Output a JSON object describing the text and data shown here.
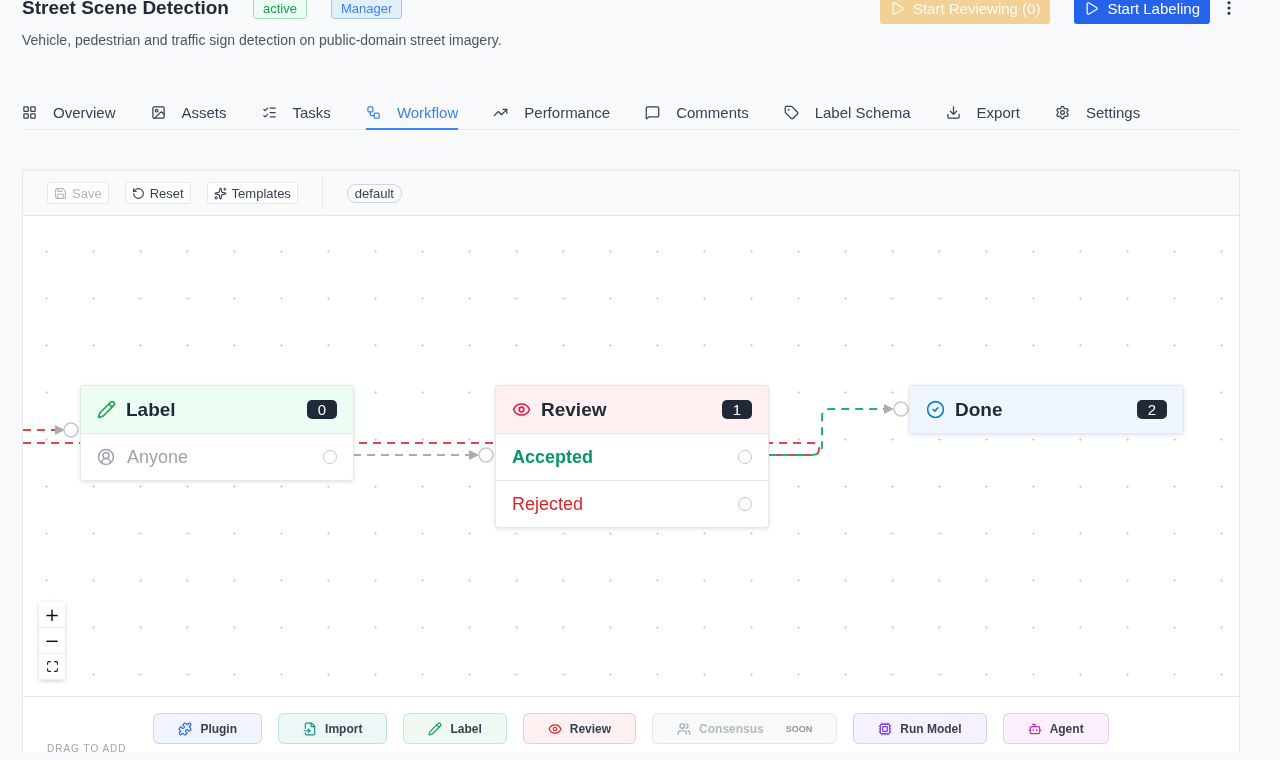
{
  "header": {
    "title": "Street Scene Detection",
    "status_badge": "active",
    "role_badge": "Manager",
    "description": "Vehicle, pedestrian and traffic sign detection on public-domain street imagery.",
    "actions": [
      {
        "label": "Start Reviewing (0)",
        "kind": "review",
        "disabled": true
      },
      {
        "label": "Start Labeling",
        "kind": "label",
        "disabled": false
      }
    ]
  },
  "tabs": [
    {
      "label": "Overview",
      "selected": false
    },
    {
      "label": "Assets",
      "selected": false
    },
    {
      "label": "Tasks",
      "selected": false
    },
    {
      "label": "Workflow",
      "selected": true
    },
    {
      "label": "Performance",
      "selected": false
    },
    {
      "label": "Comments",
      "selected": false
    },
    {
      "label": "Label Schema",
      "selected": false
    },
    {
      "label": "Export",
      "selected": false
    },
    {
      "label": "Settings",
      "selected": false
    }
  ],
  "toolbar": {
    "buttons": [
      {
        "label": "Save",
        "kind": "save",
        "disabled": true
      },
      {
        "label": "Reset",
        "kind": "reset",
        "disabled": false
      },
      {
        "label": "Templates",
        "kind": "templates",
        "disabled": false
      }
    ],
    "workflow_name": "default"
  },
  "nodes": [
    {
      "kind": "label",
      "title": "Label",
      "count": "0",
      "rows": [
        {
          "text": "Anyone",
          "kind": "assignee"
        }
      ]
    },
    {
      "kind": "review",
      "title": "Review",
      "count": "1",
      "rows": [
        {
          "text": "Accepted",
          "kind": "accept"
        },
        {
          "text": "Rejected",
          "kind": "reject"
        }
      ]
    },
    {
      "kind": "done",
      "title": "Done",
      "count": "2"
    }
  ],
  "zoom_controls": [
    "+",
    "−"
  ],
  "palette": {
    "items": [
      {
        "label": "Plugin",
        "kind": "plugin",
        "color": "#2563eb",
        "disabled": false
      },
      {
        "label": "Import",
        "kind": "import",
        "color": "#0d9488",
        "disabled": false
      },
      {
        "label": "Label",
        "kind": "label",
        "color": "#16a34a",
        "disabled": false
      },
      {
        "label": "Review",
        "kind": "review",
        "color": "#dc2626",
        "disabled": false
      },
      {
        "label": "Consensus",
        "kind": "consensus",
        "color": "#9ca3af",
        "disabled": true,
        "badge": "SOON"
      },
      {
        "label": "Run Model",
        "kind": "model",
        "color": "#7c3aed",
        "disabled": false
      },
      {
        "label": "Agent",
        "kind": "agent",
        "color": "#c026d3",
        "disabled": false
      }
    ],
    "hint": "DRAG TO ADD"
  }
}
